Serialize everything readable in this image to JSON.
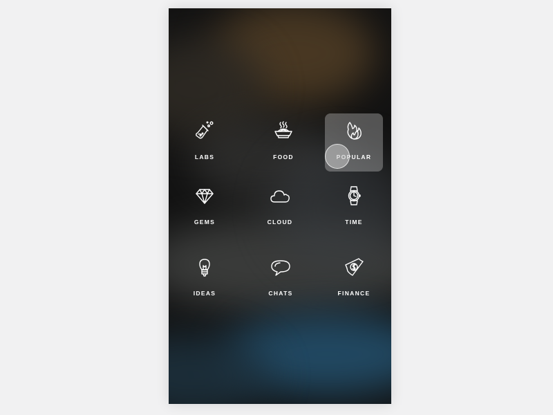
{
  "colors": {
    "page_background": "#f1f1f2",
    "text": "#ffffff",
    "icon_stroke": "#ffffff",
    "active_tile": "rgba(220,220,220,0.33)"
  },
  "categories": [
    {
      "label": "LABS",
      "icon": "flask-icon",
      "active": false
    },
    {
      "label": "FOOD",
      "icon": "food-bowl-icon",
      "active": false
    },
    {
      "label": "POPULAR",
      "icon": "flame-icon",
      "active": true
    },
    {
      "label": "GEMS",
      "icon": "diamond-icon",
      "active": false
    },
    {
      "label": "CLOUD",
      "icon": "cloud-icon",
      "active": false
    },
    {
      "label": "TIME",
      "icon": "watch-icon",
      "active": false
    },
    {
      "label": "IDEAS",
      "icon": "lightbulb-icon",
      "active": false
    },
    {
      "label": "CHATS",
      "icon": "chat-bubble-icon",
      "active": false
    },
    {
      "label": "FINANCE",
      "icon": "dollar-bill-icon",
      "active": false
    }
  ]
}
